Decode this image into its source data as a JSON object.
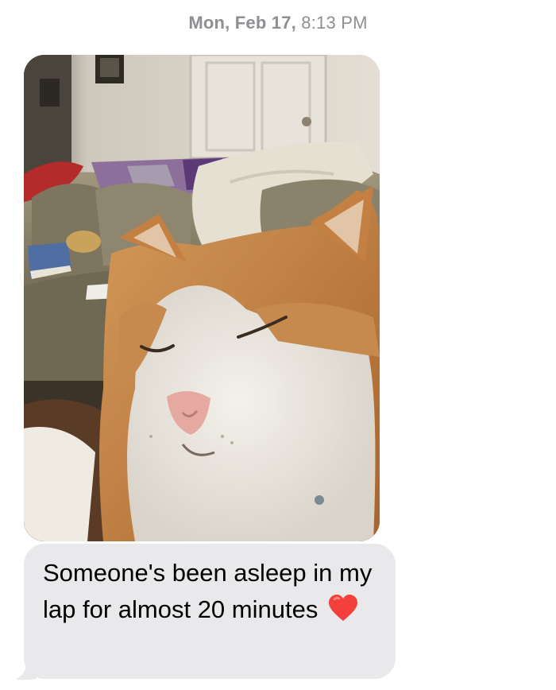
{
  "conversation": {
    "timestamp": {
      "day": "Mon, Feb 17,",
      "time": "8:13 PM"
    },
    "messages": [
      {
        "type": "image",
        "direction": "incoming",
        "image_subject": "orange-and-white cat sleeping on a lap in a living room with a couch"
      },
      {
        "type": "text",
        "direction": "incoming",
        "text": "Someone's been asleep in my lap for almost 20 minutes",
        "emoji": "red-heart-icon"
      }
    ]
  },
  "colors": {
    "bubble_incoming": "#e9e9eb",
    "timestamp_text": "#8e8e93",
    "heart": "#f3403a"
  }
}
